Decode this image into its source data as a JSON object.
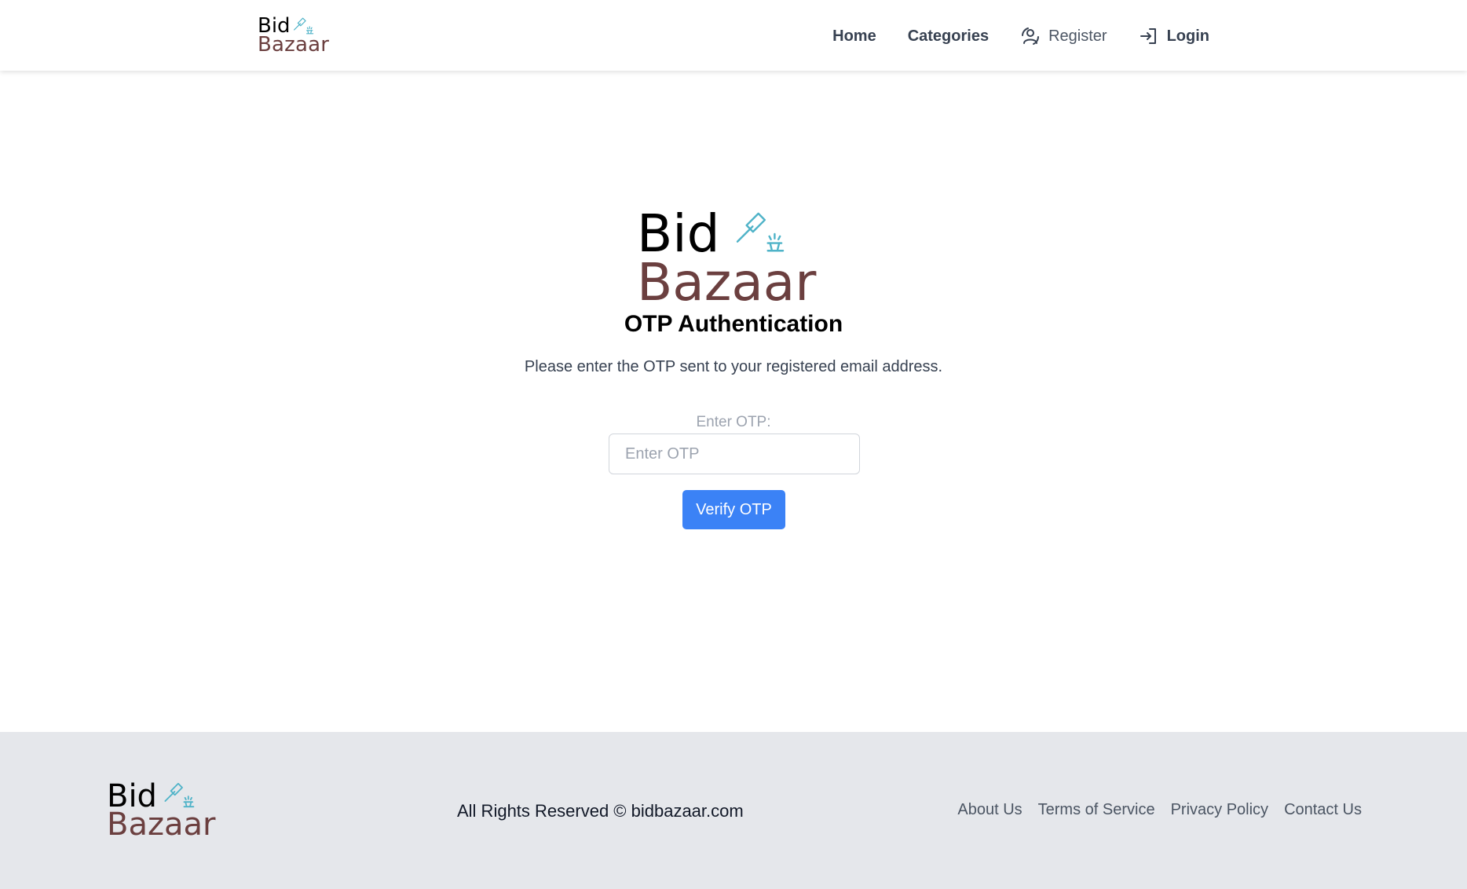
{
  "brand": {
    "line1": "Bid",
    "line2": "Bazaar",
    "icon": "gavel-icon",
    "colors": {
      "bid": "#000000",
      "bazaar": "#6b3f3f",
      "gavel": "#4fb3c8"
    }
  },
  "nav": {
    "home": "Home",
    "categories": "Categories",
    "register": {
      "label": "Register",
      "icon": "user-plus-icon"
    },
    "login": {
      "label": "Login",
      "icon": "login-icon"
    }
  },
  "otp": {
    "title": "OTP Authentication",
    "subtitle": "Please enter the OTP sent to your registered email address.",
    "label": "Enter OTP:",
    "input_value": "",
    "input_placeholder": "Enter OTP",
    "button_label": "Verify OTP",
    "button_color": "#3b82f6"
  },
  "footer": {
    "copyright": "All Rights Reserved © bidbazaar.com",
    "links": [
      "About Us",
      "Terms of Service",
      "Privacy Policy",
      "Contact Us"
    ],
    "background": "#e5e7eb"
  }
}
